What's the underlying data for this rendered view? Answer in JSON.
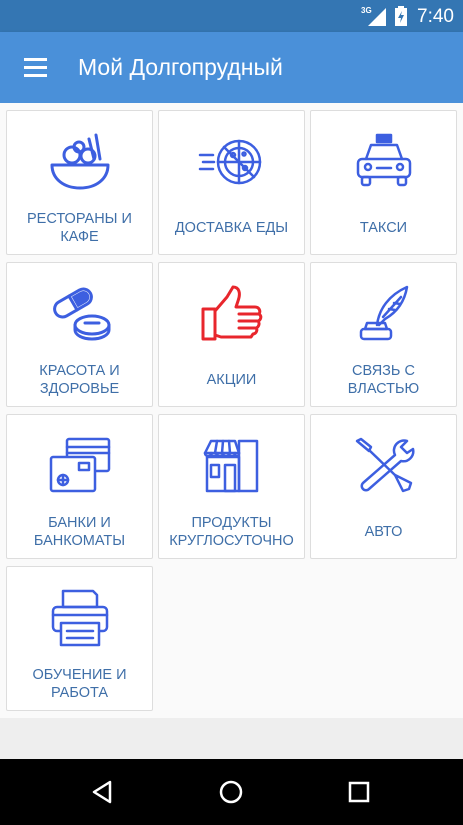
{
  "status_bar": {
    "network": "3G",
    "time": "7:40"
  },
  "app_bar": {
    "title": "Мой Долгопрудный"
  },
  "tiles": [
    {
      "label": "РЕСТОРАНЫ И КАФЕ",
      "icon": "food-bowl-icon"
    },
    {
      "label": "ДОСТАВКА ЕДЫ",
      "icon": "pizza-delivery-icon"
    },
    {
      "label": "ТАКСИ",
      "icon": "taxi-icon"
    },
    {
      "label": "КРАСОТА И ЗДОРОВЬЕ",
      "icon": "pills-icon"
    },
    {
      "label": "АКЦИИ",
      "icon": "thumbs-up-icon"
    },
    {
      "label": "СВЯЗЬ С ВЛАСТЬЮ",
      "icon": "quill-inkwell-icon"
    },
    {
      "label": "БАНКИ И БАНКОМАТЫ",
      "icon": "bank-cards-icon"
    },
    {
      "label": "ПРОДУКТЫ КРУГЛОСУТОЧНО",
      "icon": "store-icon"
    },
    {
      "label": "АВТО",
      "icon": "tools-icon"
    },
    {
      "label": "ОБУЧЕНИЕ И РАБОТА",
      "icon": "printer-icon"
    }
  ],
  "colors": {
    "primary": "#4a90d9",
    "status_bar": "#3476b3",
    "icon_blue": "#3d5fe0",
    "accent_red": "#e8262c",
    "label": "#3f6fa8"
  }
}
